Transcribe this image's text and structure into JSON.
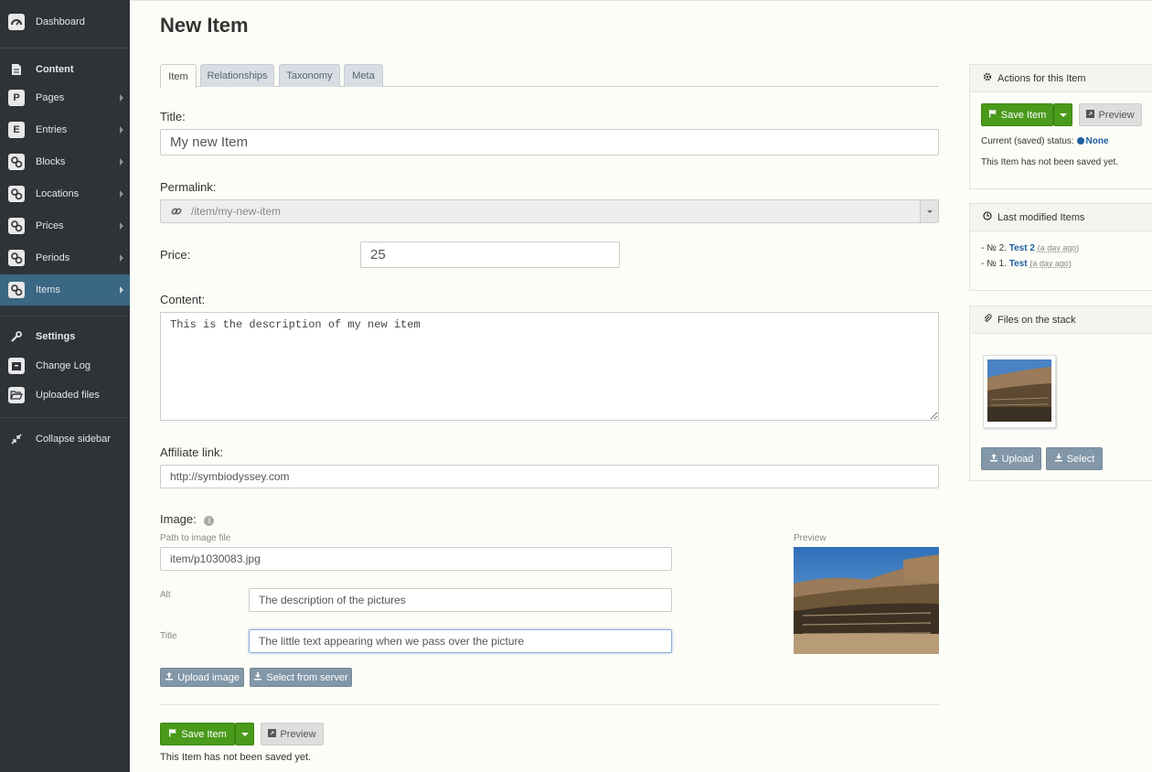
{
  "sidebar": {
    "dashboard": "Dashboard",
    "content_header": "Content",
    "items": [
      {
        "label": "Pages",
        "icon": "P"
      },
      {
        "label": "Entries",
        "icon": "E"
      },
      {
        "label": "Blocks",
        "icon": "cogs-icon"
      },
      {
        "label": "Locations",
        "icon": "cogs-icon"
      },
      {
        "label": "Prices",
        "icon": "cogs-icon"
      },
      {
        "label": "Periods",
        "icon": "cogs-icon"
      },
      {
        "label": "Items",
        "icon": "cogs-icon"
      }
    ],
    "settings_header": "Settings",
    "change_log": "Change Log",
    "uploaded_files": "Uploaded files",
    "collapse": "Collapse sidebar",
    "active_color": "#3a6784"
  },
  "page": {
    "title": "New Item"
  },
  "tabs": [
    "Item",
    "Relationships",
    "Taxonomy",
    "Meta"
  ],
  "form": {
    "title_label": "Title:",
    "title_value": "My new Item",
    "permalink_label": "Permalink:",
    "permalink_value": "/item/my-new-item",
    "price_label": "Price:",
    "price_value": "25",
    "content_label": "Content:",
    "content_value": "This is the description of my new item",
    "affiliate_label": "Affiliate link:",
    "affiliate_value": "http://symbiodyssey.com",
    "image_label": "Image:",
    "path_label": "Path to image file",
    "path_value": "item/p1030083.jpg",
    "alt_label": "Alt",
    "alt_value": "The description of the pictures",
    "img_title_label": "Title",
    "img_title_value": "The little text appearing when we pass over the picture",
    "preview_label": "Preview",
    "upload_image": "Upload image",
    "select_from_server": "Select from server"
  },
  "footer": {
    "save": "Save Item",
    "preview": "Preview",
    "not_saved": "This Item has not been saved yet."
  },
  "actions_panel": {
    "title": "Actions for this Item",
    "save": "Save Item",
    "preview": "Preview",
    "status_label": "Current (saved) status:",
    "status_value": "None",
    "not_saved": "This Item has not been saved yet."
  },
  "last_modified": {
    "title": "Last modified Items",
    "rows": [
      {
        "prefix": "- № 2.",
        "name": "Test 2",
        "ago": "(a day ago)"
      },
      {
        "prefix": "- № 1.",
        "name": "Test",
        "ago": "(a day ago)"
      }
    ]
  },
  "files_panel": {
    "title": "Files on the stack",
    "upload": "Upload",
    "select": "Select"
  },
  "colors": {
    "green": "#4a9a1b",
    "link": "#1f5ea1",
    "sidebar": "#2e3338"
  }
}
